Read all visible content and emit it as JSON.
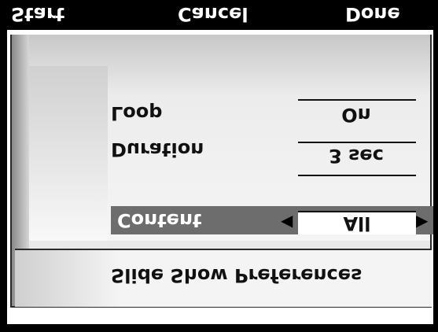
{
  "softkeys": {
    "start": "Start",
    "cancel": "Cancel",
    "done": "Done"
  },
  "preferences": {
    "loop": {
      "label": "Loop",
      "value": "On"
    },
    "duration": {
      "label": "Duration",
      "value": "3 sec"
    },
    "content": {
      "label": "Content",
      "value": "All"
    }
  },
  "title": "Slide Show Preferences"
}
